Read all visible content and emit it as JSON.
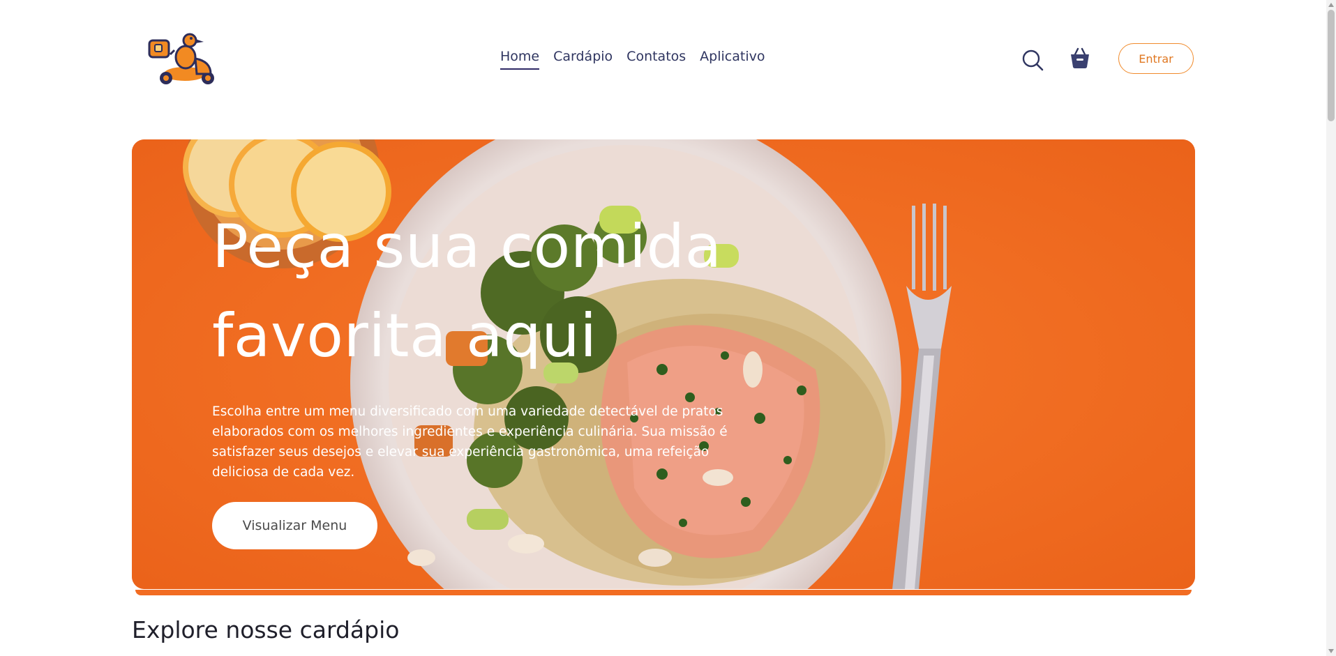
{
  "header": {
    "logo_icon": "scooter-delivery-duck-logo",
    "nav": [
      {
        "label": "Home",
        "active": true
      },
      {
        "label": "Cardápio",
        "active": false
      },
      {
        "label": "Contatos",
        "active": false
      },
      {
        "label": "Aplicativo",
        "active": false
      }
    ],
    "search_icon": "search-icon",
    "cart_icon": "basket-icon",
    "login_label": "Entrar"
  },
  "hero": {
    "title_line1": "Peça sua comida",
    "title_line2": "favorita aqui",
    "description": "Escolha entre um menu diversificado com uma variedade detectável de pratos elaborados com os melhores ingredientes e experiência culinária. Sua missão é satisfazer seus desejos e elevar sua experiência gastronômica, uma refeição deliciosa de cada vez.",
    "cta_label": "Visualizar Menu",
    "background_color": "#f26c22"
  },
  "section": {
    "title": "Explore nosse cardápio"
  },
  "colors": {
    "accent": "#f08a2b",
    "nav_text": "#2f3560",
    "active_underline": "#2f2a66"
  }
}
